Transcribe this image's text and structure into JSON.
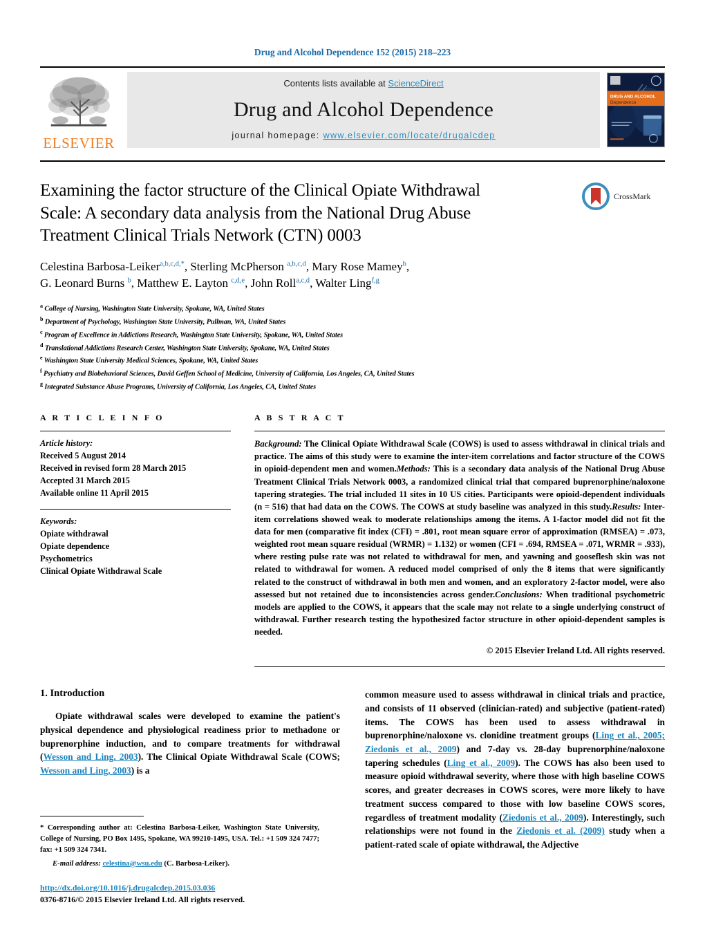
{
  "running_head": "Drug and Alcohol Dependence 152 (2015) 218–223",
  "masthead": {
    "elsevier_wordmark": "ELSEVIER",
    "contents_prefix": "Contents lists available at ",
    "sciencedirect": "ScienceDirect",
    "journal_title": "Drug and Alcohol Dependence",
    "homepage_prefix": "journal homepage: ",
    "homepage_url": "www.elsevier.com/locate/drugalcdep",
    "cover_line1": "DRUG AND ALCOHOL",
    "cover_line2": "Dependence"
  },
  "crossmark": {
    "label": "CrossMark"
  },
  "article": {
    "title": "Examining the factor structure of the Clinical Opiate Withdrawal Scale: A secondary data analysis from the National Drug Abuse Treatment Clinical Trials Network (CTN) 0003",
    "authors_line1_html": "Celestina Barbosa-Leiker<sup>a,b,c,d,*</sup>, Sterling McPherson <sup>a,b,c,d</sup>, Mary Rose Mamey<sup>b</sup>,",
    "authors_line2_html": "G. Leonard Burns <sup>b</sup>, Matthew E. Layton <sup>c,d,e</sup>, John Roll<sup>a,c,d</sup>, Walter Ling<sup>f,g</sup>",
    "affiliations": [
      {
        "mark": "a",
        "text": "College of Nursing, Washington State University, Spokane, WA, United States"
      },
      {
        "mark": "b",
        "text": "Department of Psychology, Washington State University, Pullman, WA, United States"
      },
      {
        "mark": "c",
        "text": "Program of Excellence in Addictions Research, Washington State University, Spokane, WA, United States"
      },
      {
        "mark": "d",
        "text": "Translational Addictions Research Center, Washington State University, Spokane, WA, United States"
      },
      {
        "mark": "e",
        "text": "Washington State University Medical Sciences, Spokane, WA, United States"
      },
      {
        "mark": "f",
        "text": "Psychiatry and Biobehavioral Sciences, David Geffen School of Medicine, University of California, Los Angeles, CA, United States"
      },
      {
        "mark": "g",
        "text": "Integrated Substance Abuse Programs, University of California, Los Angeles, CA, United States"
      }
    ]
  },
  "article_info": {
    "heading": "A R T I C L E    I N F O",
    "history_label": "Article history:",
    "history": [
      "Received 5 August 2014",
      "Received in revised form 28 March 2015",
      "Accepted 31 March 2015",
      "Available online 11 April 2015"
    ],
    "keywords_label": "Keywords:",
    "keywords": [
      "Opiate withdrawal",
      "Opiate dependence",
      "Psychometrics",
      "Clinical Opiate Withdrawal Scale"
    ]
  },
  "abstract": {
    "heading": "A B S T R A C T",
    "background_label": "Background:",
    "background": " The Clinical Opiate Withdrawal Scale (COWS) is used to assess withdrawal in clinical trials and practice. The aims of this study were to examine the inter-item correlations and factor structure of the COWS in opioid-dependent men and women.",
    "methods_label": "Methods:",
    "methods": " This is a secondary data analysis of the National Drug Abuse Treatment Clinical Trials Network 0003, a randomized clinical trial that compared buprenorphine/naloxone tapering strategies. The trial included 11 sites in 10 US cities. Participants were opioid-dependent individuals (n = 516) that had data on the COWS. The COWS at study baseline was analyzed in this study.",
    "results_label": "Results:",
    "results": " Inter-item correlations showed weak to moderate relationships among the items. A 1-factor model did not fit the data for men (comparative fit index (CFI) = .801, root mean square error of approximation (RMSEA) = .073, weighted root mean square residual (WRMR) = 1.132) or women (CFI = .694, RMSEA = .071, WRMR = .933), where resting pulse rate was not related to withdrawal for men, and yawning and gooseflesh skin was not related to withdrawal for women. A reduced model comprised of only the 8 items that were significantly related to the construct of withdrawal in both men and women, and an exploratory 2-factor model, were also assessed but not retained due to inconsistencies across gender.",
    "conclusions_label": "Conclusions:",
    "conclusions": " When traditional psychometric models are applied to the COWS, it appears that the scale may not relate to a single underlying construct of withdrawal. Further research testing the hypothesized factor structure in other opioid-dependent samples is needed.",
    "copyright": "© 2015 Elsevier Ireland Ltd. All rights reserved."
  },
  "introduction": {
    "heading": "1.  Introduction",
    "left_p1_part1": "Opiate withdrawal scales were developed to examine the patient's physical dependence and physiological readiness prior to methadone or buprenorphine induction, and to compare treatments for withdrawal (",
    "left_ref1": "Wesson and Ling, 2003",
    "left_p1_part2": "). The Clinical Opiate Withdrawal Scale (COWS; ",
    "left_ref2": "Wesson and Ling, 2003",
    "left_p1_part3": ") is a",
    "right_part1": "common measure used to assess withdrawal in clinical trials and practice, and consists of 11 observed (clinician-rated) and subjective (patient-rated) items. The COWS has been used to assess withdrawal in buprenorphine/naloxone vs. clonidine treatment groups (",
    "right_ref1": "Ling et al., 2005; Ziedonis et al., 2009",
    "right_part2": ") and 7-day vs. 28-day buprenorphine/naloxone tapering schedules (",
    "right_ref2": "Ling et al., 2009",
    "right_part3": "). The COWS has also been used to measure opioid withdrawal severity, where those with high baseline COWS scores, and greater decreases in COWS scores, were more likely to have treatment success compared to those with low baseline COWS scores, regardless of treatment modality (",
    "right_ref3": "Ziedonis et al., 2009",
    "right_part4": "). Interestingly, such relationships were not found in the ",
    "right_ref4": "Ziedonis et al. (2009)",
    "right_part5": " study when a patient-rated scale of opiate withdrawal, the Adjective"
  },
  "footnote": {
    "star": "*",
    "corresponding": " Corresponding author at: Celestina Barbosa-Leiker, Washington State University, College of Nursing, PO Box 1495, Spokane, WA 99210-1495, USA. Tel.: +1 509 324 7477; fax: +1 509 324 7341.",
    "email_label": "E-mail address:",
    "email": "celestina@wsu.edu",
    "email_suffix": " (C. Barbosa-Leiker)."
  },
  "doi_block": {
    "doi": "http://dx.doi.org/10.1016/j.drugalcdep.2015.03.036",
    "issn": "0376-8716/© 2015 Elsevier Ireland Ltd. All rights reserved."
  },
  "colors": {
    "link_blue": "#1b84bd",
    "header_blue": "#1b6ca8",
    "elsevier_orange": "#ef7d22",
    "band_gray": "#e8e8e8",
    "cover_navy": "#0d1c3d"
  }
}
